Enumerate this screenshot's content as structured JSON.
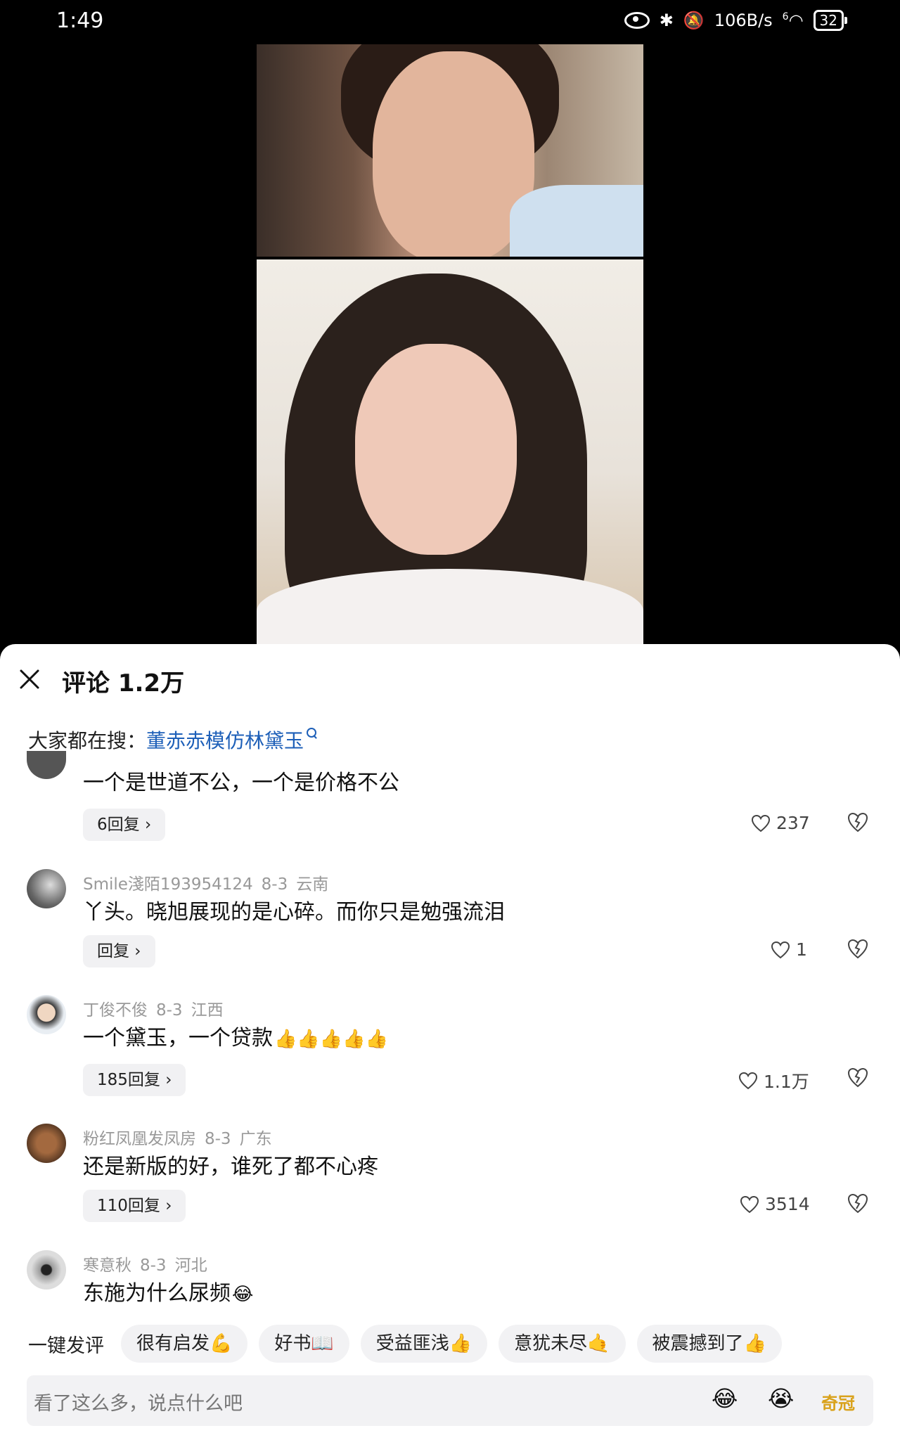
{
  "status_bar": {
    "time": "1:49",
    "net_speed": "106B/s",
    "wifi_label": "6",
    "battery": "32"
  },
  "panel": {
    "title": "评论 1.2万",
    "search_prefix": "大家都在搜：",
    "search_term": "董赤赤模仿林黛玉"
  },
  "comments": [
    {
      "user": "",
      "date": "",
      "location": "",
      "text": "一个是世道不公，一个是价格不公",
      "emoji": "",
      "reply": "6回复 ›",
      "likes": "237"
    },
    {
      "user": "Smile淺陌193954124",
      "date": "8-3",
      "location": "云南",
      "text": "丫头。晓旭展现的是心碎。而你只是勉强流泪",
      "emoji": "",
      "reply": "回复 ›",
      "likes": "1"
    },
    {
      "user": "丁俊不俊",
      "date": "8-3",
      "location": "江西",
      "text": "一个黛玉，一个贷款",
      "emoji": "👍👍👍👍👍",
      "reply": "185回复 ›",
      "likes": "1.1万"
    },
    {
      "user": "粉红凤凰发凤房",
      "date": "8-3",
      "location": "广东",
      "text": "还是新版的好，谁死了都不心疼",
      "emoji": "",
      "reply": "110回复 ›",
      "likes": "3514"
    },
    {
      "user": "寒意秋",
      "date": "8-3",
      "location": "河北",
      "text": "东施为什么尿频",
      "emoji": "😂",
      "reply": "",
      "likes": ""
    }
  ],
  "quick_comment": {
    "label": "一键发评",
    "chips": [
      "很有启发💪",
      "好书📖",
      "受益匪浅👍",
      "意犹未尽🤙",
      "被震撼到了👍"
    ]
  },
  "input": {
    "placeholder": "看了这么多，说点什么吧",
    "emojis": [
      "😂",
      "😭",
      "奇冠"
    ]
  },
  "colors": {
    "link": "#1d5fb8",
    "panel_bg": "#ffffff",
    "chip_bg": "#f2f2f4"
  }
}
